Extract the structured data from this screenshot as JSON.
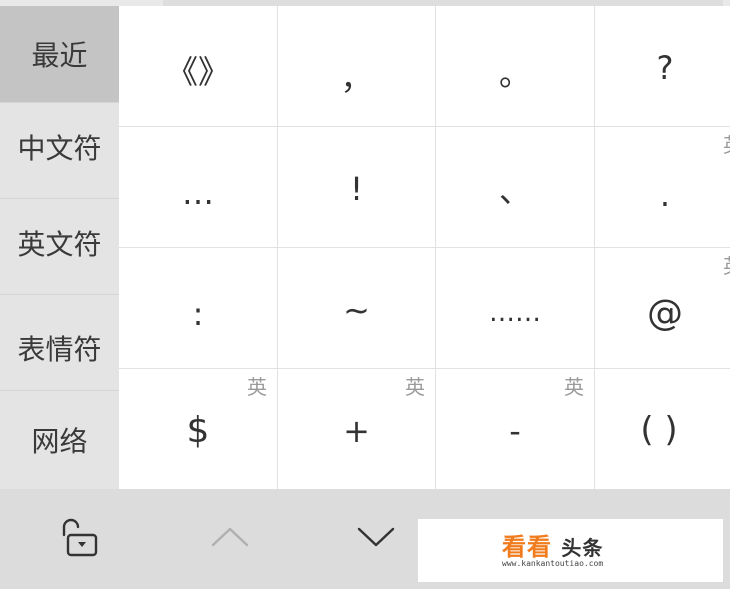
{
  "sidebar": {
    "items": [
      {
        "label": "最近"
      },
      {
        "label": "中文符"
      },
      {
        "label": "英文符"
      },
      {
        "label": "表情符"
      },
      {
        "label": "网络"
      }
    ]
  },
  "grid": {
    "rows": [
      [
        {
          "symbol": "《》",
          "tag": ""
        },
        {
          "symbol": "，",
          "tag": ""
        },
        {
          "symbol": "。",
          "tag": ""
        },
        {
          "symbol": "?",
          "tag": ""
        }
      ],
      [
        {
          "symbol": "…",
          "tag": ""
        },
        {
          "symbol": "!",
          "tag": ""
        },
        {
          "symbol": "、",
          "tag": ""
        },
        {
          "symbol": ".",
          "tag": "英"
        }
      ],
      [
        {
          "symbol": ":",
          "tag": ""
        },
        {
          "symbol": "~",
          "tag": ""
        },
        {
          "symbol": "……",
          "tag": ""
        },
        {
          "symbol": "@",
          "tag": "英"
        }
      ],
      [
        {
          "symbol": "$",
          "tag": "英"
        },
        {
          "symbol": "+",
          "tag": "英"
        },
        {
          "symbol": "-",
          "tag": "英"
        },
        {
          "symbol": "( )",
          "tag": ""
        }
      ]
    ]
  },
  "toolbar": {
    "lock_icon": "unlock-icon",
    "up_icon": "chevron-up-icon",
    "down_icon": "chevron-down-icon"
  },
  "watermark": {
    "brand": "看看",
    "brand_suffix": "头条",
    "url": "www.kankantoutiao.com"
  },
  "colors": {
    "sidebar_bg": "#e4e4e4",
    "sidebar_active": "#c4c4c4",
    "toolbar_bg": "#dcdcdc",
    "brand_orange": "#f07c1e"
  }
}
